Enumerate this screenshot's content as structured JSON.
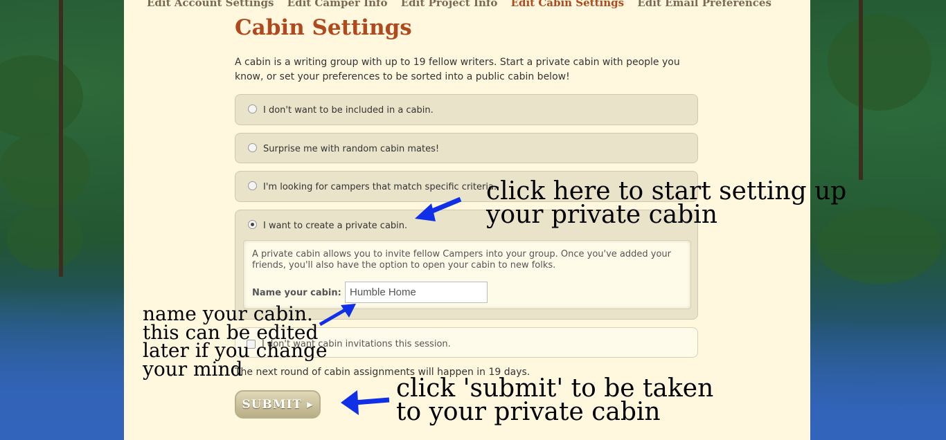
{
  "tabs": [
    {
      "label": "Edit Account Settings"
    },
    {
      "label": "Edit Camper Info"
    },
    {
      "label": "Edit Project Info"
    },
    {
      "label": "Edit Cabin Settings"
    },
    {
      "label": "Edit Email Preferences"
    }
  ],
  "page": {
    "title": "Cabin Settings",
    "intro": "A cabin is a writing group with up to 19 fellow writers. Start a private cabin with people you know, or set your preferences to be sorted into a public cabin below!"
  },
  "options": [
    {
      "label": "I don't want to be included in a cabin.",
      "checked": false
    },
    {
      "label": "Surprise me with random cabin mates!",
      "checked": false
    },
    {
      "label": "I'm looking for campers that match specific criteria.",
      "checked": false
    },
    {
      "label": "I want to create a private cabin.",
      "checked": true
    }
  ],
  "private_cabin": {
    "description": "A private cabin allows you to invite fellow Campers into your group. Once you've added your friends, you'll also have the option to open your cabin to new folks.",
    "name_label": "Name your cabin:",
    "name_value": "Humble Home"
  },
  "invitations": {
    "label": "I don't want cabin invitations this session.",
    "checked": false
  },
  "next_round": "The next round of cabin assignments will happen in 19 days.",
  "submit_label": "SUBMIT",
  "annotations": {
    "private_cabin_note": [
      "click here to start setting up",
      "your private cabin"
    ],
    "name_note": [
      "name your cabin.",
      "this can be edited",
      "later if you change",
      "your mind"
    ],
    "submit_note": [
      "click 'submit' to be taken",
      "to your private cabin"
    ],
    "arrow_color": "#1030e8"
  }
}
